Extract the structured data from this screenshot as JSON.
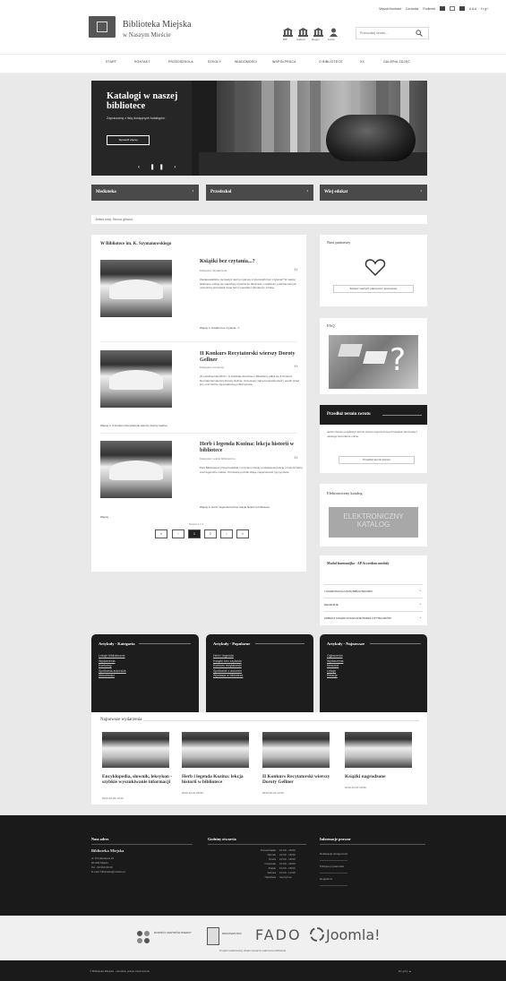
{
  "utility": {
    "contrast": "Wysoki kontrast",
    "zoom": "Czcionka",
    "reading": "Podkreśl",
    "lang": "A A A",
    "social": "f t g+"
  },
  "logo": {
    "line1": "Biblioteka Miejska",
    "line2": "w Naszym Mieście"
  },
  "header_icons": [
    "BIP",
    "Galeria",
    "Regon",
    "Konto"
  ],
  "search": {
    "placeholder": "Przeszukaj serwis..."
  },
  "nav": [
    "Start",
    "Kontakt",
    "Przedszkola",
    "Szkoły",
    "Wiadomości",
    "Współpraca",
    "O bibliotece",
    "XX",
    "Galeria zdjęć"
  ],
  "banner": {
    "title": "Katalogi w naszej bibliotece",
    "subtitle": "Zapraszamy z listą dostępnych katalogów.",
    "button": "Sprawdź więcej",
    "controls": "‹ ❚❚ ›"
  },
  "dropdowns": [
    "Mediateka",
    "Przedszkol",
    "Wiej edukat"
  ],
  "breadcrumb": "Jesteś tutaj:  Strona główna",
  "main": {
    "heading": "W Bibliotece im. K. Szymanowskiego",
    "articles": [
      {
        "title": "Książki bez czytania...?",
        "category": "Kategoria: Wydarzenia",
        "text": "Zastanawialiście się kiedyś nad tym jak się czyta książki bez czytania? W naszej bibliotece odbyły się warsztaty czytelnicze dla dzieci i młodzieży, podczas których uczestnicy poznawali nowe formy kontaktu z literaturą i sztuką.",
        "more": "Więcej o: Książki bez czytania...?",
        "social": "f  t"
      },
      {
        "title": "II Konkurs Recytatorski wierszy Doroty Gellner",
        "category": "Kategoria: Konkursy",
        "text": "22 października 2013 r. w Oddziale dla Dzieci i Młodzieży odbył się II Konkurs Recytatorski wierszy Doroty Gellner. Uczestnicy zaprezentowali utwory poetki przed jury oraz licznie zgromadzoną publicznością.",
        "more": "Więcej o: II Konkurs Recytatorski wierszy Doroty Gellner",
        "social": "f  t"
      },
      {
        "title": "Herb i legenda Kozina: lekcja historii w bibliotece",
        "category": "Kategoria: Lekcje biblioteczne",
        "text": "Pani Bibliotekarz przeprowadziła z uczniami szkoły podstawowej lekcję o historii herbu oraz legendzie miasta. Uczniowie poznali dzieje miejscowości i jej symbole.",
        "more": "Więcej o: Herb i legenda Kozina: lekcja historii w bibliotece",
        "social": "f  t"
      }
    ],
    "more_link": "Więcej...",
    "page_label": "Strona 1 z 2",
    "pagination": [
      "«",
      "‹",
      "1",
      "2",
      "›",
      "»"
    ]
  },
  "sidebar": {
    "partners": {
      "title": "Nasi partnerzy",
      "button": "Zobacz naszych partnerów i sponsorów"
    },
    "faq": {
      "title": "FAQ"
    },
    "extend": {
      "title": "Przedłuż termin zwrotu",
      "text": "Jeżeli chcesz przedłużyć termin zwrotu wypożyczonych książek skorzystaj z naszego formularza online.",
      "button": "Przedłuż termin zwrotu"
    },
    "catalog": {
      "title": "Elektroniczny katalog",
      "banner_line1": "ELEKTRONICZNY",
      "banner_line2": "KATALOG"
    },
    "module": {
      "title": "Moduł harmonijka - AP Accordion moduły",
      "rows": [
        "I NAGRODA DLA PANI BIBLIOTEKARKI",
        "RECENZJE",
        "ZOBACZ KSIĄŻKI POLECANE PRZEZ CZYTELNIKÓW"
      ]
    }
  },
  "cat_panels": [
    {
      "title": "Artykuły - Kategoria",
      "links": [
        "Lekcje biblioteczne",
        "Wydarzenia",
        "Konkursy",
        "Spotkania autorskie",
        "Aktualności"
      ]
    },
    {
      "title": "Artykuły - Popularne",
      "links": [
        "Herb i legenda",
        "Książki bez czytania",
        "Konkurs recytatorski",
        "Spotkanie z autorem",
        "Wystawa w bibliotece"
      ]
    },
    {
      "title": "Artykuły - Najnowsze",
      "links": [
        "Ogłoszenia",
        "Wydarzenia",
        "Nowości",
        "Lekcje",
        "Relacje"
      ]
    }
  ],
  "newest": {
    "title": "Najnowsze wydarzenia",
    "items": [
      {
        "title": "Encyklopedia, słownik, leksykon - szybkie wyszukiwanie informacji",
        "date": "2013-10-29 13:20"
      },
      {
        "title": "Herb i legenda Kozina: lekcja historii w bibliotece",
        "date": "2013-10-21 09:00"
      },
      {
        "title": "II Konkurs Recytatorski wierszy Doroty Gellner",
        "date": "2013-10-22 12:00"
      },
      {
        "title": "Książki nagrodzone",
        "date": "2013-10-15 10:00"
      }
    ]
  },
  "footer": {
    "col1": {
      "title": "Nasz adres",
      "name": "Biblioteka Miejska",
      "lines": [
        "ul. Przykładowa 10",
        "00-000 Miasto",
        "Tel.: 00 000 00 00",
        "E-mail: biblioteka@miasto.pl"
      ]
    },
    "col2": {
      "title": "Godziny otwarcia",
      "days": [
        "Poniedziałek",
        "Wtorek",
        "Środa",
        "Czwartek",
        "Piątek",
        "Sobota",
        "Niedziela"
      ],
      "hours": [
        "10:00 - 18:00",
        "10:00 - 18:00",
        "10:00 - 18:00",
        "10:00 - 18:00",
        "10:00 - 18:00",
        "10:00 - 14:00",
        "nieczynne"
      ]
    },
    "col3": {
      "title": "Informacje prawne",
      "links": [
        "Deklaracja dostępności",
        "Polityka prywatności",
        "Regulamin"
      ]
    }
  },
  "partners_logos": [
    "ROZWÓJ CENTRÓW WIEDZY",
    "MINISTERSTWO",
    "FADO",
    "Joomla!"
  ],
  "partners_caption": "Projekt realizowany dzięki wsparciu partnerów biblioteki.",
  "bottom": {
    "left": "© Biblioteka Miejska - wszelkie prawa zastrzeżone",
    "right": "Do góry ▲"
  }
}
